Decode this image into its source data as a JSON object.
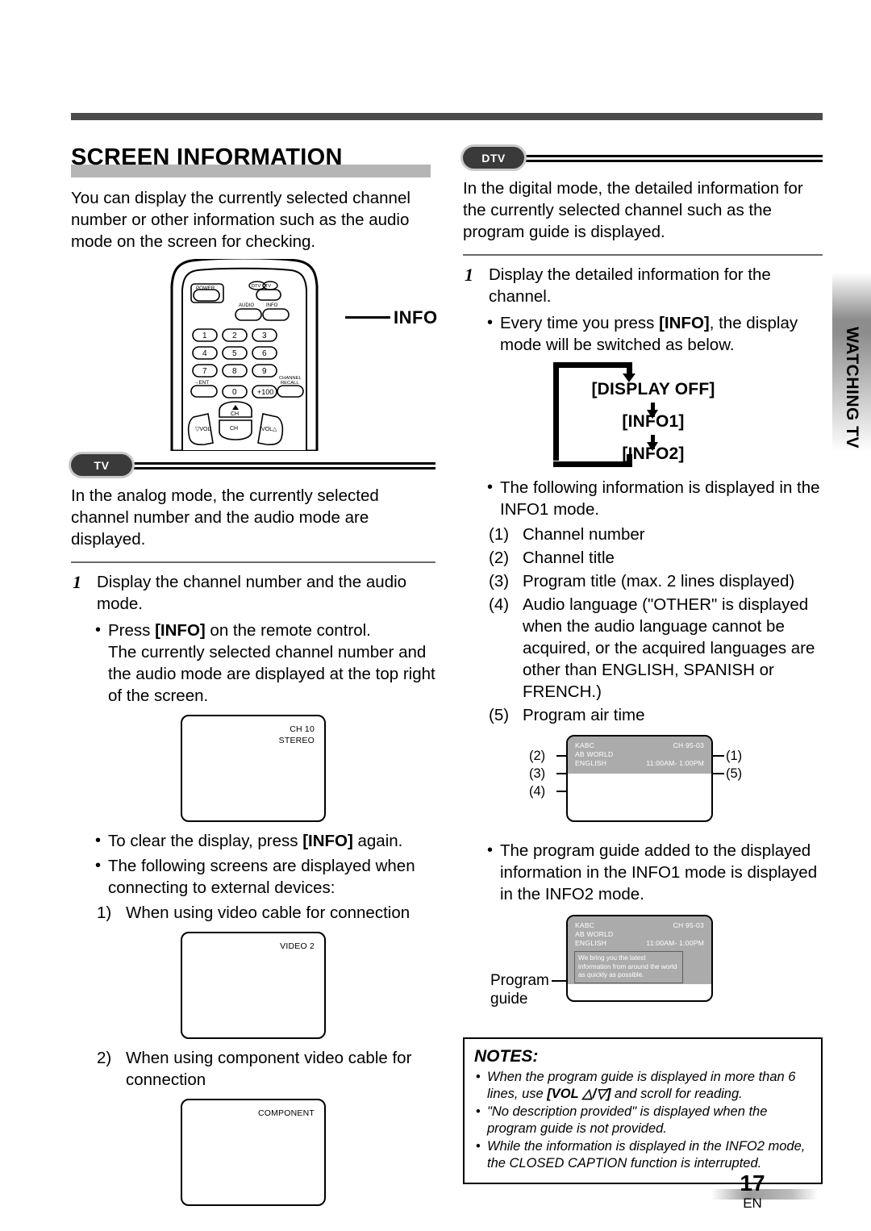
{
  "page": {
    "number": "17",
    "language_code": "EN",
    "side_tab": "WATCHING TV"
  },
  "left_column": {
    "heading": "SCREEN INFORMATION",
    "intro": "You can display the currently selected channel number or other information such as the audio mode on the screen for checking.",
    "remote": {
      "callout_label": "INFO",
      "buttons": {
        "power": "POWER",
        "dtv": "DTV",
        "tv": "TV",
        "audio": "AUDIO",
        "info": "INFO",
        "one": "1",
        "two": "2",
        "three": "3",
        "four": "4",
        "five": "5",
        "six": "6",
        "seven": "7",
        "eight": "8",
        "nine": "9",
        "ent": "→ENT",
        "zero": "0",
        "plus100": "+100",
        "channel_recall": "CHANNEL RECALL",
        "ch": "CH",
        "vol_down": "▽VOL",
        "vol_up": "VOL△"
      }
    },
    "tv_section": {
      "badge": "TV",
      "intro": "In the analog mode, the currently selected channel number and the audio mode are displayed.",
      "step_number": "1",
      "step_text": "Display the channel number and the audio mode.",
      "bullet1_pre": "Press ",
      "bullet1_key": "[INFO]",
      "bullet1_post": " on the remote control.",
      "bullet1_cont": "The currently selected channel number and the audio mode are displayed at the top right of the screen.",
      "screen_analog": {
        "line1": "CH 10",
        "line2": "STEREO"
      },
      "bullet2_pre": "To clear the display, press ",
      "bullet2_key": "[INFO]",
      "bullet2_post": " again.",
      "bullet3": "The following screens are displayed when connecting to external devices:",
      "sub1_label": "1)",
      "sub1_text": "When using video cable for connection",
      "screen_video": {
        "line1": "VIDEO 2"
      },
      "sub2_label": "2)",
      "sub2_text": "When using component video cable for connection",
      "screen_component": {
        "line1": "COMPONENT"
      }
    }
  },
  "right_column": {
    "dtv_section": {
      "badge": "DTV",
      "intro": "In the digital mode, the detailed information for the currently selected channel such as the program guide is displayed.",
      "step_number": "1",
      "step_text": "Display the detailed information for the channel.",
      "bullet1_pre": "Every time you press ",
      "bullet1_key": "[INFO]",
      "bullet1_post": ", the display mode will be switched as below.",
      "flow": {
        "item1": "[DISPLAY OFF]",
        "item2": "[INFO1]",
        "item3": "[INFO2]"
      },
      "bullet2": "The following information is displayed in the INFO1 mode.",
      "items": [
        {
          "label": "(1)",
          "text": "Channel number"
        },
        {
          "label": "(2)",
          "text": "Channel title"
        },
        {
          "label": "(3)",
          "text": "Program title (max. 2 lines displayed)"
        },
        {
          "label": "(4)",
          "text": "Audio language (\"OTHER\" is displayed when the audio language cannot be acquired, or the acquired languages are other than ENGLISH, SPANISH or FRENCH.)"
        },
        {
          "label": "(5)",
          "text": "Program air time"
        }
      ],
      "info1_screen": {
        "channel_title": "KABC",
        "channel_number": "CH 95-03",
        "program_title": "AB WORLD",
        "audio_language": "ENGLISH",
        "air_time": "11:00AM- 1:00PM",
        "callout_1": "(1)",
        "callout_2": "(2)",
        "callout_3": "(3)",
        "callout_4": "(4)",
        "callout_5": "(5)"
      },
      "bullet3": "The program guide added to the displayed information in the INFO1 mode is displayed in the INFO2 mode.",
      "info2_screen": {
        "channel_title": "KABC",
        "channel_number": "CH 95-03",
        "program_title": "AB WORLD",
        "audio_language": "ENGLISH",
        "air_time": "11:00AM- 1:00PM",
        "guide_text": "We bring you the latest information from around the world as quickly as possible.",
        "guide_label_line1": "Program",
        "guide_label_line2": "guide"
      }
    },
    "notes": {
      "title": "NOTES:",
      "note1_a": "When the program guide is displayed in more than 6 lines, use ",
      "note1_key": "[VOL △/▽]",
      "note1_b": " and scroll for reading.",
      "note2": "\"No description provided\" is displayed when the program guide is not provided.",
      "note3": "While the information is displayed in the INFO2 mode, the CLOSED CAPTION function is interrupted."
    }
  }
}
